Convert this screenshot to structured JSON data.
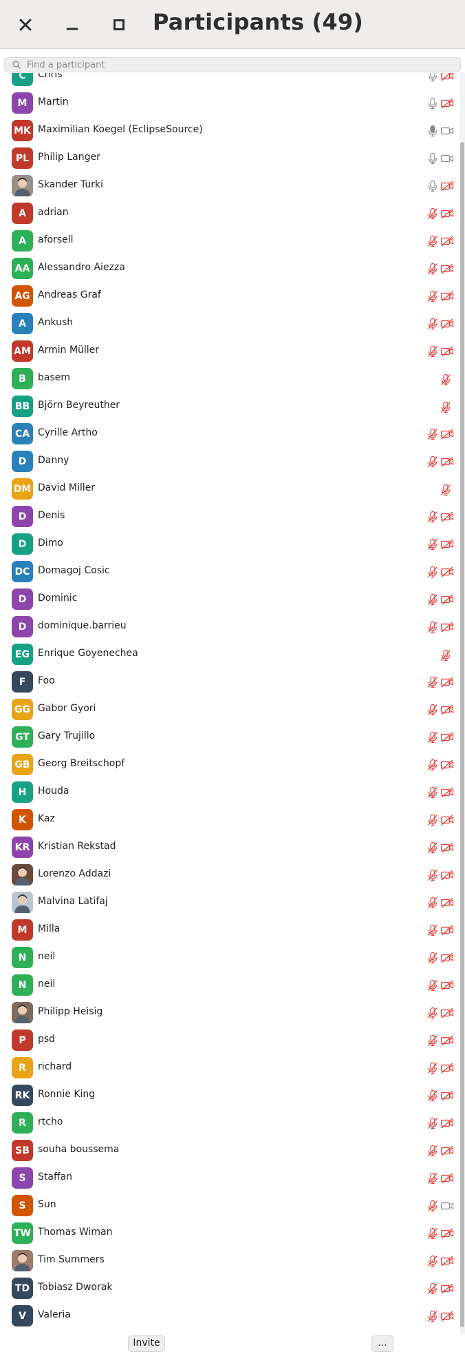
{
  "window": {
    "title": "Participants (49)",
    "close_icon": "close-icon",
    "minimize_icon": "minimize-icon",
    "maximize_icon": "maximize-icon"
  },
  "search": {
    "placeholder": "Find a participant",
    "value": ""
  },
  "colors": {
    "muted_red": "#e53935",
    "icon_gray": "#8a8a8a",
    "green": "#2eb057",
    "purple": "#8e44ad",
    "red": "#c0392b",
    "teal": "#16a085",
    "blue": "#2a80b9",
    "orange": "#e8a317",
    "dark_orange": "#d35400",
    "navy": "#34495e"
  },
  "participants": [
    {
      "initials": "C",
      "name": "Chris",
      "color": "#16a085",
      "mic": "on",
      "cam": "off"
    },
    {
      "initials": "M",
      "name": "Martin",
      "color": "#8e44ad",
      "mic": "on",
      "cam": "off"
    },
    {
      "initials": "MK",
      "name": "Maximilian Koegel (EclipseSource)",
      "color": "#c0392b",
      "mic": "active",
      "cam": "on"
    },
    {
      "initials": "PL",
      "name": "Philip Langer",
      "color": "#c0392b",
      "mic": "on",
      "cam": "on"
    },
    {
      "initials": "",
      "name": "Skander Turki",
      "color": "#9a8f86",
      "photo": true,
      "mic": "on",
      "cam": "off"
    },
    {
      "initials": "A",
      "name": "adrian",
      "color": "#c0392b",
      "mic": "off",
      "cam": "off"
    },
    {
      "initials": "A",
      "name": "aforsell",
      "color": "#2eb057",
      "mic": "off",
      "cam": "off"
    },
    {
      "initials": "AA",
      "name": "Alessandro Aiezza",
      "color": "#2eb057",
      "mic": "off",
      "cam": "off"
    },
    {
      "initials": "AG",
      "name": "Andreas Graf",
      "color": "#d35400",
      "mic": "off",
      "cam": "off"
    },
    {
      "initials": "A",
      "name": "Ankush",
      "color": "#2a80b9",
      "mic": "off",
      "cam": "off"
    },
    {
      "initials": "AM",
      "name": "Armin Müller",
      "color": "#c0392b",
      "mic": "off",
      "cam": "off"
    },
    {
      "initials": "B",
      "name": "basem",
      "color": "#2eb057",
      "mic": "off",
      "cam": "none"
    },
    {
      "initials": "BB",
      "name": "Björn Beyreuther",
      "color": "#16a085",
      "mic": "off",
      "cam": "none"
    },
    {
      "initials": "CA",
      "name": "Cyrille Artho",
      "color": "#2a80b9",
      "mic": "off",
      "cam": "off"
    },
    {
      "initials": "D",
      "name": "Danny",
      "color": "#2a80b9",
      "mic": "off",
      "cam": "off"
    },
    {
      "initials": "DM",
      "name": "David Miller",
      "color": "#e8a317",
      "mic": "off",
      "cam": "none"
    },
    {
      "initials": "D",
      "name": "Denis",
      "color": "#8e44ad",
      "mic": "off",
      "cam": "off"
    },
    {
      "initials": "D",
      "name": "Dimo",
      "color": "#16a085",
      "mic": "off",
      "cam": "off"
    },
    {
      "initials": "DC",
      "name": "Domagoj Cosic",
      "color": "#2a80b9",
      "mic": "off",
      "cam": "off"
    },
    {
      "initials": "D",
      "name": "Dominic",
      "color": "#8e44ad",
      "mic": "off",
      "cam": "off"
    },
    {
      "initials": "D",
      "name": "dominique.barrieu",
      "color": "#8e44ad",
      "mic": "off",
      "cam": "off"
    },
    {
      "initials": "EG",
      "name": "Enrique Goyenechea",
      "color": "#16a085",
      "mic": "off",
      "cam": "none"
    },
    {
      "initials": "F",
      "name": "Foo",
      "color": "#34495e",
      "mic": "off",
      "cam": "off"
    },
    {
      "initials": "GG",
      "name": "Gabor Gyori",
      "color": "#e8a317",
      "mic": "off",
      "cam": "off"
    },
    {
      "initials": "GT",
      "name": "Gary Trujillo",
      "color": "#2eb057",
      "mic": "off",
      "cam": "off"
    },
    {
      "initials": "GB",
      "name": "Georg Breitschopf",
      "color": "#e8a317",
      "mic": "off",
      "cam": "off"
    },
    {
      "initials": "H",
      "name": "Houda",
      "color": "#16a085",
      "mic": "off",
      "cam": "off"
    },
    {
      "initials": "K",
      "name": "Kaz",
      "color": "#d35400",
      "mic": "off",
      "cam": "off"
    },
    {
      "initials": "KR",
      "name": "Kristian Rekstad",
      "color": "#8e44ad",
      "mic": "off",
      "cam": "off"
    },
    {
      "initials": "",
      "name": "Lorenzo Addazi",
      "color": "#6b4a3a",
      "photo": true,
      "mic": "off",
      "cam": "off"
    },
    {
      "initials": "",
      "name": "Malvina Latifaj",
      "color": "#b8c4cf",
      "photo": true,
      "mic": "off",
      "cam": "off"
    },
    {
      "initials": "M",
      "name": "Milla",
      "color": "#c0392b",
      "mic": "off",
      "cam": "off"
    },
    {
      "initials": "N",
      "name": "neil",
      "color": "#2eb057",
      "mic": "off",
      "cam": "off"
    },
    {
      "initials": "N",
      "name": "neil",
      "color": "#2eb057",
      "mic": "off",
      "cam": "off"
    },
    {
      "initials": "",
      "name": "Philipp Heisig",
      "color": "#7d6b5d",
      "photo": true,
      "mic": "off",
      "cam": "off"
    },
    {
      "initials": "P",
      "name": "psd",
      "color": "#c0392b",
      "mic": "off",
      "cam": "off"
    },
    {
      "initials": "R",
      "name": "richard",
      "color": "#e8a317",
      "mic": "off",
      "cam": "off"
    },
    {
      "initials": "RK",
      "name": "Ronnie King",
      "color": "#34495e",
      "mic": "off",
      "cam": "off"
    },
    {
      "initials": "R",
      "name": "rtcho",
      "color": "#2eb057",
      "mic": "off",
      "cam": "off"
    },
    {
      "initials": "SB",
      "name": "souha boussema",
      "color": "#c0392b",
      "mic": "off",
      "cam": "off"
    },
    {
      "initials": "S",
      "name": "Staffan",
      "color": "#8e44ad",
      "mic": "off",
      "cam": "off"
    },
    {
      "initials": "S",
      "name": "Sun",
      "color": "#d35400",
      "mic": "off",
      "cam": "on"
    },
    {
      "initials": "TW",
      "name": "Thomas Wiman",
      "color": "#2eb057",
      "mic": "off",
      "cam": "off"
    },
    {
      "initials": "",
      "name": "Tim Summers",
      "color": "#a07b6a",
      "photo": true,
      "mic": "off",
      "cam": "off"
    },
    {
      "initials": "TD",
      "name": "Tobiasz Dworak",
      "color": "#34495e",
      "mic": "off",
      "cam": "off"
    },
    {
      "initials": "V",
      "name": "Valeria",
      "color": "#34495e",
      "mic": "off",
      "cam": "off"
    }
  ],
  "footer": {
    "invite_label": "Invite",
    "more_label": "..."
  }
}
